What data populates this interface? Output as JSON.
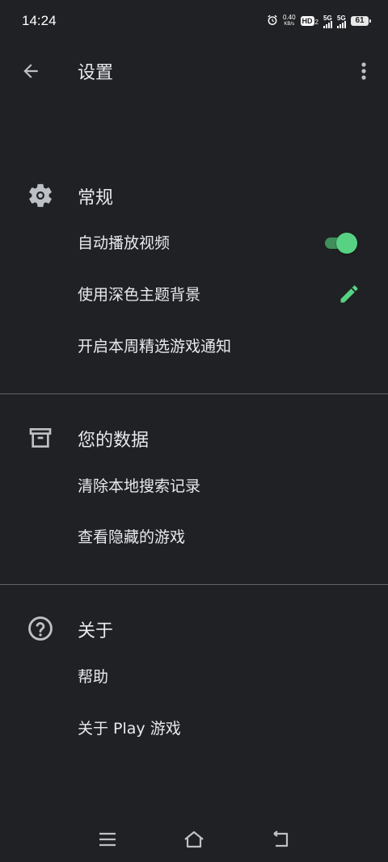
{
  "status_bar": {
    "time": "14:24",
    "net_speed_value": "0.40",
    "net_speed_unit": "KB/s",
    "hd_label": "HD",
    "hd_sub": "2",
    "signal1_label": "5G",
    "signal2_label": "5G",
    "battery_level": "61"
  },
  "app_bar": {
    "title": "设置"
  },
  "sections": {
    "general": {
      "title": "常规",
      "autoplay_label": "自动播放视频",
      "autoplay_on": true,
      "dark_theme_label": "使用深色主题背景",
      "weekly_notify_label": "开启本周精选游戏通知"
    },
    "data": {
      "title": "您的数据",
      "clear_history_label": "清除本地搜索记录",
      "hidden_games_label": "查看隐藏的游戏"
    },
    "about": {
      "title": "关于",
      "help_label": "帮助",
      "about_play_label": "关于 Play 游戏"
    }
  },
  "colors": {
    "background": "#202124",
    "accent": "#57d283",
    "divider": "#5f6368"
  }
}
